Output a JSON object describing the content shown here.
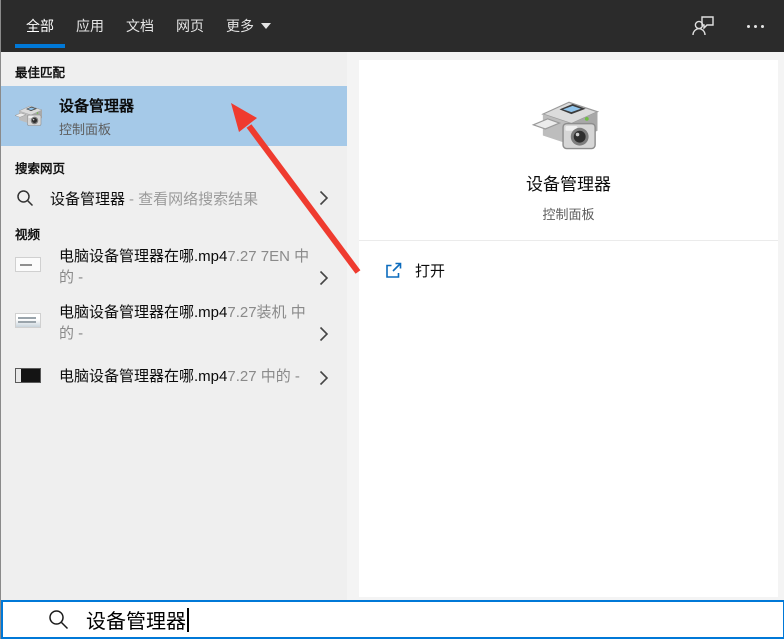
{
  "topbar": {
    "tabs": [
      {
        "label": "全部",
        "active": true
      },
      {
        "label": "应用",
        "active": false
      },
      {
        "label": "文档",
        "active": false
      },
      {
        "label": "网页",
        "active": false
      },
      {
        "label": "更多",
        "active": false,
        "has_dropdown": true
      }
    ],
    "icons": [
      "feedback-icon",
      "ellipsis-icon"
    ]
  },
  "left_panel": {
    "best_match": {
      "header": "最佳匹配",
      "item": {
        "title": "设备管理器",
        "subtitle": "控制面板",
        "icon": "device-manager-icon",
        "highlighted": true
      }
    },
    "web_search": {
      "header": "搜索网页",
      "item": {
        "query": "设备管理器",
        "hint": "- 查看网络搜索结果",
        "icon": "search-icon"
      }
    },
    "videos": {
      "header": "视频",
      "items": [
        {
          "title": "电脑设备管理器在哪.mp4",
          "meta": "7.27 7EN 中的 -",
          "icon": "video-thumbnail"
        },
        {
          "title": "电脑设备管理器在哪.mp4",
          "meta": "7.27装机 中的 -",
          "icon": "video-thumbnail"
        },
        {
          "title": "电脑设备管理器在哪.mp4",
          "meta": "7.27 中的 -",
          "icon": "video-thumbnail"
        }
      ]
    }
  },
  "preview": {
    "title": "设备管理器",
    "subtitle": "控制面板",
    "icon": "device-manager-icon",
    "open_label": "打开"
  },
  "search": {
    "value": "设备管理器"
  },
  "annotation": {
    "type": "red-arrow",
    "points_at": "best-match-item"
  },
  "colors": {
    "topbar_bg": "#2b2b2b",
    "accent_blue": "#0078d7",
    "best_match_highlight": "#a5c9e8",
    "left_panel_bg": "#efefef",
    "arrow_red": "#ef3b2f"
  }
}
